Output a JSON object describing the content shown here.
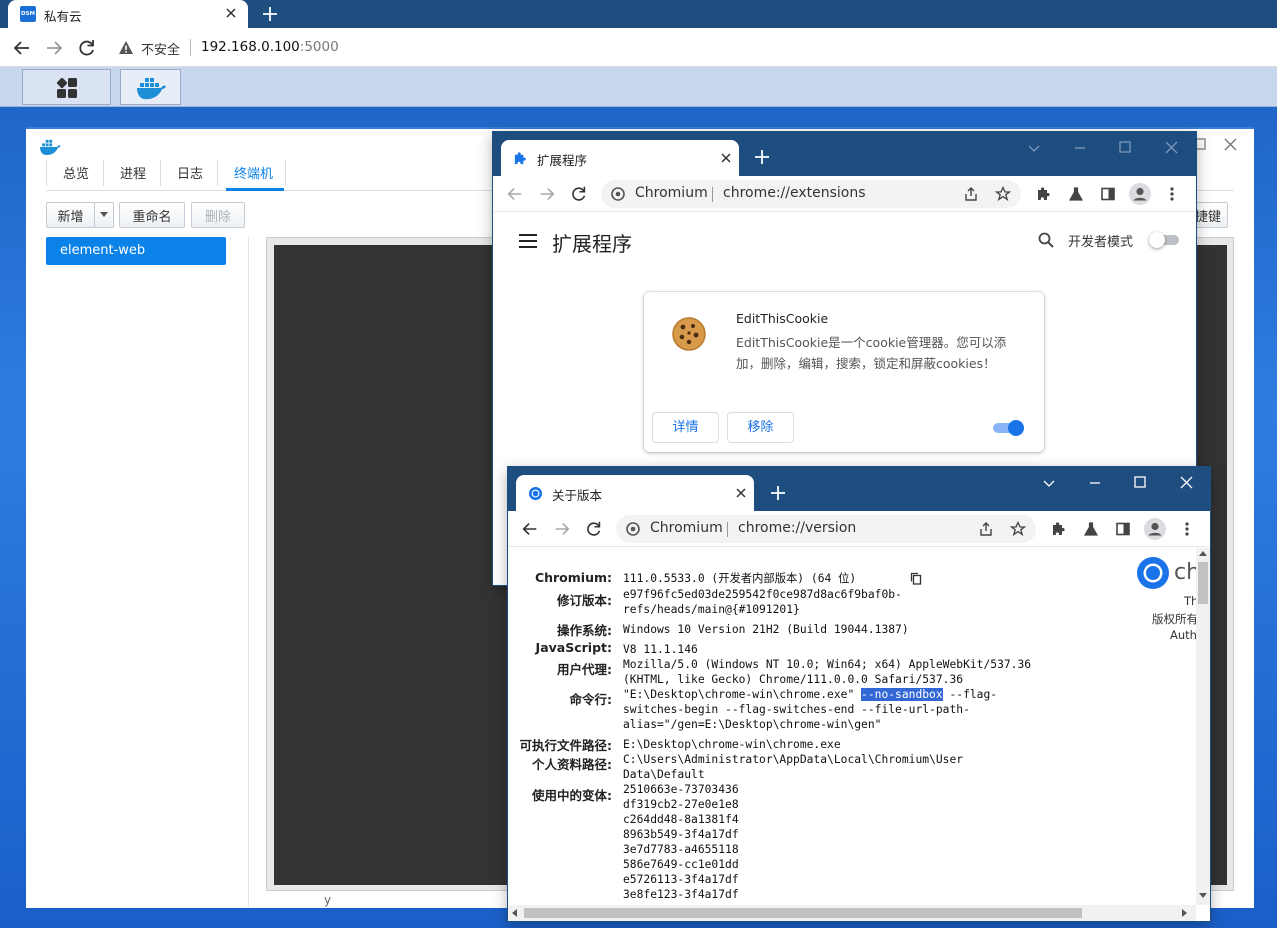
{
  "outer_browser": {
    "tab_title": "私有云",
    "tab_favicon_text": "DSM",
    "security_label": "不安全",
    "url_host": "192.168.0.100",
    "url_port": ":5000"
  },
  "dsm": {
    "tabs": [
      "总览",
      "进程",
      "日志",
      "终端机"
    ],
    "active_tab": "终端机",
    "buttons": {
      "add": "新增",
      "rename": "重命名",
      "delete": "删除"
    },
    "right_button_partial": "快捷键",
    "containers": [
      "element-web"
    ],
    "bottom_partial": "y"
  },
  "extensions_window": {
    "tab_title": "扩展程序",
    "omnibox_label": "Chromium",
    "omnibox_url": "chrome://extensions",
    "page_title": "扩展程序",
    "dev_mode_label": "开发者模式",
    "extension": {
      "name": "EditThisCookie",
      "description": "EditThisCookie是一个cookie管理器。您可以添加，删除，编辑，搜索，锁定和屏蔽cookies！",
      "details_label": "详情",
      "remove_label": "移除",
      "enabled": true
    }
  },
  "version_window": {
    "tab_title": "关于版本",
    "omnibox_label": "Chromium",
    "omnibox_url": "chrome://version",
    "side_partial": {
      "logo_text": "ch",
      "line1": "Th",
      "line2": "版权所有",
      "line3": "Auth"
    },
    "rows": {
      "chromium": {
        "label": "Chromium:",
        "value": "111.0.5533.0 (开发者内部版本) (64 位)"
      },
      "revision": {
        "label": "修订版本:",
        "line1": "e97f96fc5ed03de259542f0ce987d8ac6f9baf0b-",
        "line2": "refs/heads/main@{#1091201}"
      },
      "os": {
        "label": "操作系统:",
        "value": "Windows 10 Version 21H2 (Build 19044.1387)"
      },
      "js": {
        "label": "JavaScript:",
        "value": "V8 11.1.146"
      },
      "ua": {
        "label": "用户代理:",
        "line1": "Mozilla/5.0 (Windows NT 10.0; Win64; x64) AppleWebKit/537.36",
        "line2": "(KHTML, like Gecko) Chrome/111.0.0.0 Safari/537.36"
      },
      "cmd": {
        "label": "命令行:",
        "pre": "\"E:\\Desktop\\chrome-win\\chrome.exe\" ",
        "highlight": "--no-sandbox",
        "post": " --flag-",
        "line2": "switches-begin --flag-switches-end --file-url-path-",
        "line3": "alias=\"/gen=E:\\Desktop\\chrome-win\\gen\""
      },
      "exe": {
        "label": "可执行文件路径:",
        "value": "E:\\Desktop\\chrome-win\\chrome.exe"
      },
      "profile": {
        "label": "个人资料路径:",
        "line1": "C:\\Users\\Administrator\\AppData\\Local\\Chromium\\User",
        "line2": "Data\\Default"
      },
      "variations": {
        "label": "使用中的变体:",
        "values": [
          "2510663e-73703436",
          "df319cb2-27e0e1e8",
          "c264dd48-8a1381f4",
          "8963b549-3f4a17df",
          "3e7d7783-a4655118",
          "586e7649-cc1e01dd",
          "e5726113-3f4a17df",
          "3e8fe123-3f4a17df"
        ]
      }
    }
  },
  "colors": {
    "tabstrip": "#1e4d80",
    "dsm_accent": "#0a82e8",
    "toggle_on": "#1a73e8",
    "selection": "#3367d6"
  }
}
